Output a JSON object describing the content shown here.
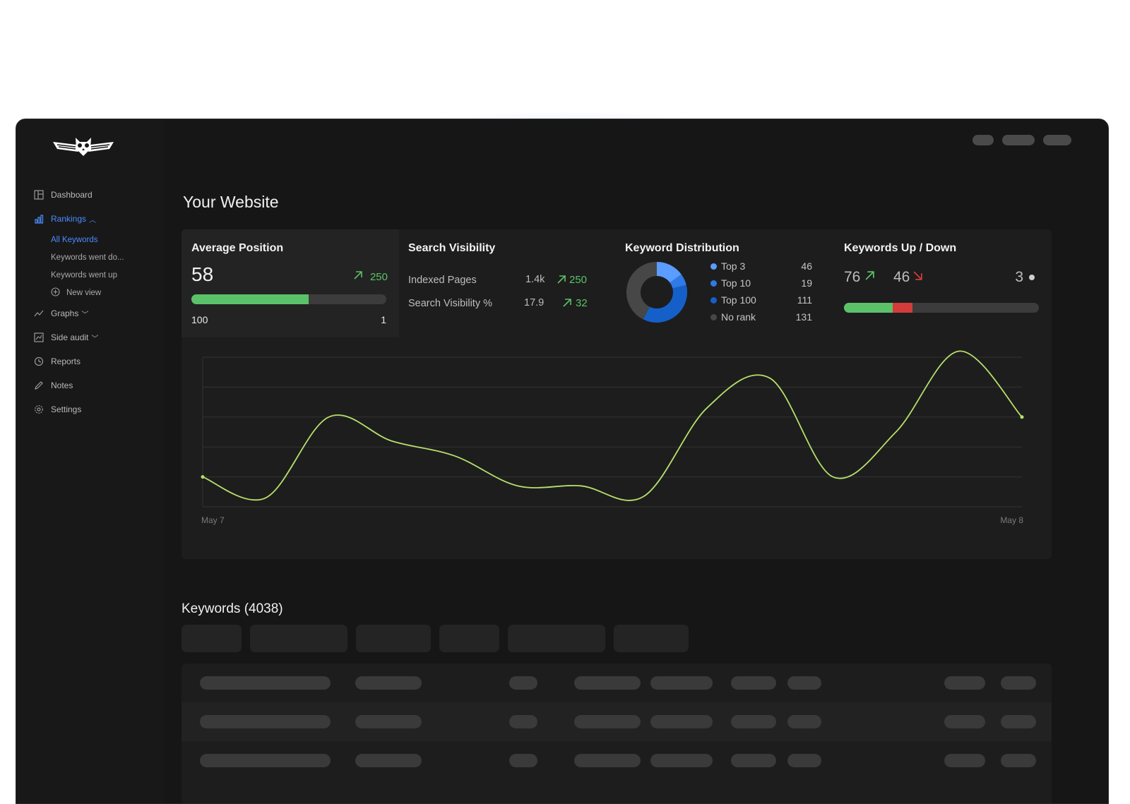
{
  "sidebar": {
    "items": [
      {
        "label": "Dashboard",
        "icon": "dashboard-icon"
      },
      {
        "label": "Rankings",
        "icon": "bar-chart-icon"
      },
      {
        "label": "Graphs",
        "icon": "trend-icon"
      },
      {
        "label": "Side audit",
        "icon": "audit-icon"
      },
      {
        "label": "Reports",
        "icon": "reports-icon"
      },
      {
        "label": "Notes",
        "icon": "pencil-icon"
      },
      {
        "label": "Settings",
        "icon": "gear-icon"
      }
    ],
    "rankings_sub": [
      "All Keywords",
      "Keywords went do...",
      "Keywords went up",
      "New view"
    ]
  },
  "page": {
    "title": "Your Website"
  },
  "average_position": {
    "title": "Average Position",
    "value": "58",
    "change": "250",
    "min_label": "100",
    "max_label": "1",
    "fill_fraction": 0.6
  },
  "search_visibility": {
    "title": "Search Visibility",
    "rows": [
      {
        "label": "Indexed Pages",
        "value": "1.4k",
        "change": "250"
      },
      {
        "label": "Search Visibility %",
        "value": "17.9",
        "change": "32"
      }
    ]
  },
  "keyword_distribution": {
    "title": "Keyword Distribution",
    "items": [
      {
        "label": "Top 3",
        "value": "46",
        "color": "#5a9cff"
      },
      {
        "label": "Top 10",
        "value": "19",
        "color": "#2f7ae6"
      },
      {
        "label": "Top 100",
        "value": "111",
        "color": "#1560c8"
      },
      {
        "label": "No rank",
        "value": "131",
        "color": "#474747"
      }
    ]
  },
  "keywords_updown": {
    "title": "Keywords Up / Down",
    "up": "76",
    "down": "46",
    "neutral": "3",
    "up_fraction": 0.25,
    "down_fraction": 0.1
  },
  "chart_data": {
    "type": "line",
    "x_start_label": "May 7",
    "x_end_label": "May 8",
    "ylim": [
      0,
      5
    ],
    "grid": true,
    "series": [
      {
        "values": [
          1.0,
          0.3,
          3.0,
          2.2,
          1.7,
          0.7,
          0.7,
          0.35,
          3.3,
          4.3,
          1.0,
          2.5,
          5.2,
          3.0
        ]
      }
    ],
    "line_color": "#b7e06c"
  },
  "keywords": {
    "title": "Keywords (4038)"
  },
  "colors": {
    "accent": "#4a8cff",
    "up": "#5bc26a",
    "down": "#d43c3c"
  }
}
